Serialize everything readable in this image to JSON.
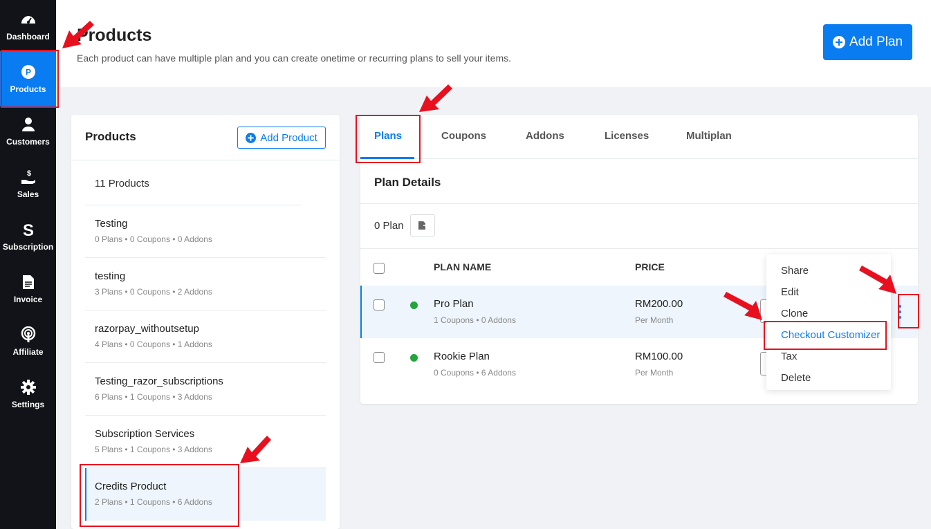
{
  "sidebar": {
    "items": [
      {
        "label": "Dashboard",
        "icon": "dashboard-icon"
      },
      {
        "label": "Products",
        "icon": "products-icon",
        "active": true
      },
      {
        "label": "Customers",
        "icon": "customers-icon"
      },
      {
        "label": "Sales",
        "icon": "sales-icon"
      },
      {
        "label": "Subscription",
        "icon": "subscription-icon"
      },
      {
        "label": "Invoice",
        "icon": "invoice-icon"
      },
      {
        "label": "Affiliate",
        "icon": "affiliate-icon"
      },
      {
        "label": "Settings",
        "icon": "gear-icon"
      }
    ]
  },
  "header": {
    "title": "Products",
    "subtitle": "Each product can have multiple plan and you can create onetime or recurring plans to sell your items.",
    "add_plan_label": "Add Plan"
  },
  "products_panel": {
    "title": "Products",
    "add_product_label": "Add Product",
    "count_text": "11 Products",
    "items": [
      {
        "name": "Testing",
        "meta": "0 Plans  • 0 Coupons  • 0 Addons"
      },
      {
        "name": "testing",
        "meta": "3 Plans  • 0 Coupons  • 2 Addons"
      },
      {
        "name": "razorpay_withoutsetup",
        "meta": "4 Plans  • 0 Coupons  • 1 Addons"
      },
      {
        "name": "Testing_razor_subscriptions",
        "meta": "6 Plans  • 1 Coupons  • 3 Addons"
      },
      {
        "name": "Subscription Services",
        "meta": "5 Plans  • 1 Coupons  • 3 Addons"
      },
      {
        "name": "Credits Product",
        "meta": "2 Plans  • 1 Coupons  • 6 Addons",
        "selected": true
      }
    ]
  },
  "plans_panel": {
    "tabs": [
      "Plans",
      "Coupons",
      "Addons",
      "Licenses",
      "Multiplan"
    ],
    "section_title": "Plan Details",
    "plan_count": "0 Plan",
    "columns": {
      "name": "PLAN NAME",
      "price": "PRICE"
    },
    "rows": [
      {
        "name": "Pro Plan",
        "meta": "1 Coupons  • 0 Addons",
        "price": "RM200.00",
        "period": "Per Month",
        "status_color": "#22a53b"
      },
      {
        "name": "Rookie Plan",
        "meta": "0 Coupons  • 6 Addons",
        "price": "RM100.00",
        "period": "Per Month",
        "status_color": "#22a53b"
      }
    ]
  },
  "dropdown": {
    "items": [
      "Share",
      "Edit",
      "Clone",
      "Checkout Customizer",
      "Tax",
      "Delete"
    ]
  },
  "colors": {
    "accent": "#0a7cf2",
    "sidebar_bg": "#111318",
    "annotation_red": "#e8101f",
    "status_green": "#22a53b"
  }
}
